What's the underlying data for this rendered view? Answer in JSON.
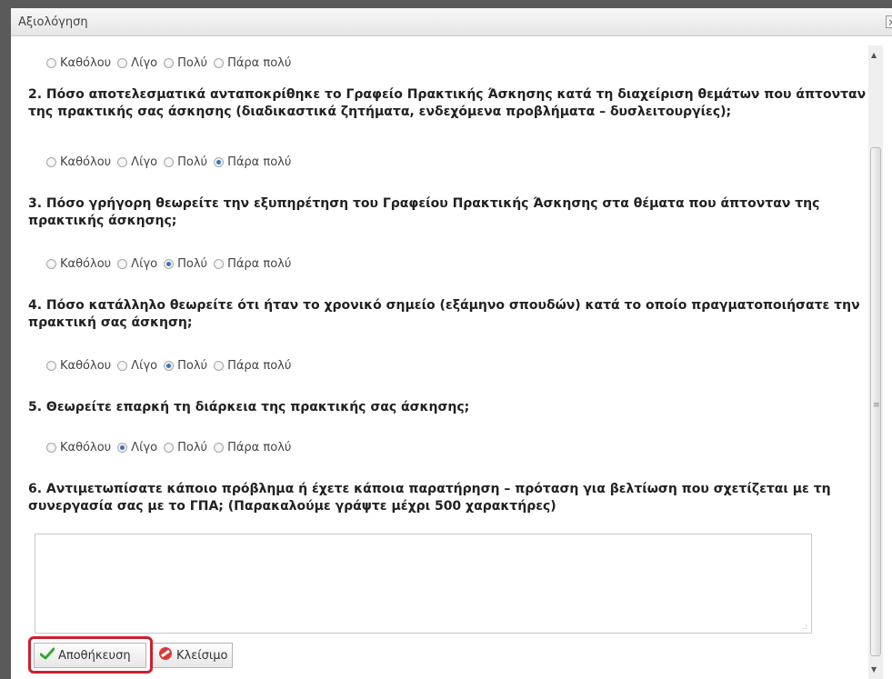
{
  "dialog": {
    "title": "Αξιολόγηση",
    "close_label": "×"
  },
  "option_labels": [
    "Καθόλου",
    "Λίγο",
    "Πολύ",
    "Πάρα πολύ"
  ],
  "question1_selected": null,
  "questions": [
    {
      "text": "2. Πόσο αποτελεσματικά ανταποκρίθηκε το Γραφείο Πρακτικής Άσκησης κατά τη διαχείριση θεμάτων που άπτονταν της πρακτικής σας άσκησης (διαδικαστικά ζητήματα, ενδεχόμενα προβλήματα – δυσλειτουργίες);",
      "selected": "Πάρα πολύ"
    },
    {
      "text": "3. Πόσο γρήγορη θεωρείτε την εξυπηρέτηση του Γραφείου Πρακτικής Άσκησης στα θέματα που άπτονταν της πρακτικής άσκησης;",
      "selected": "Πολύ"
    },
    {
      "text": "4. Πόσο κατάλληλο θεωρείτε ότι ήταν το χρονικό σημείο (εξάμηνο σπουδών) κατά το οποίο πραγματοποιήσατε την πρακτική σας άσκηση;",
      "selected": "Πολύ"
    },
    {
      "text": "5. Θεωρείτε επαρκή τη διάρκεια της πρακτικής σας άσκησης;",
      "selected": "Λίγο"
    },
    {
      "text": "6. Αντιμετωπίσατε κάποιο πρόβλημα ή έχετε κάποια παρατήρηση – πρόταση για βελτίωση που σχετίζεται με τη συνεργασία σας με το ΓΠΑ; (Παρακαλούμε γράψτε μέχρι 500 χαρακτήρες)"
    }
  ],
  "comment": {
    "value": ""
  },
  "buttons": {
    "save_label": "Αποθήκευση",
    "close_label": "Κλείσιμο"
  },
  "colors": {
    "highlight": "#cc1f2e",
    "radio_checked": "#3b6fc4",
    "save_icon": "#3aa53a",
    "close_icon": "#d93a3a"
  },
  "icons": {
    "save": "checkmark-icon",
    "close": "no-entry-icon"
  }
}
